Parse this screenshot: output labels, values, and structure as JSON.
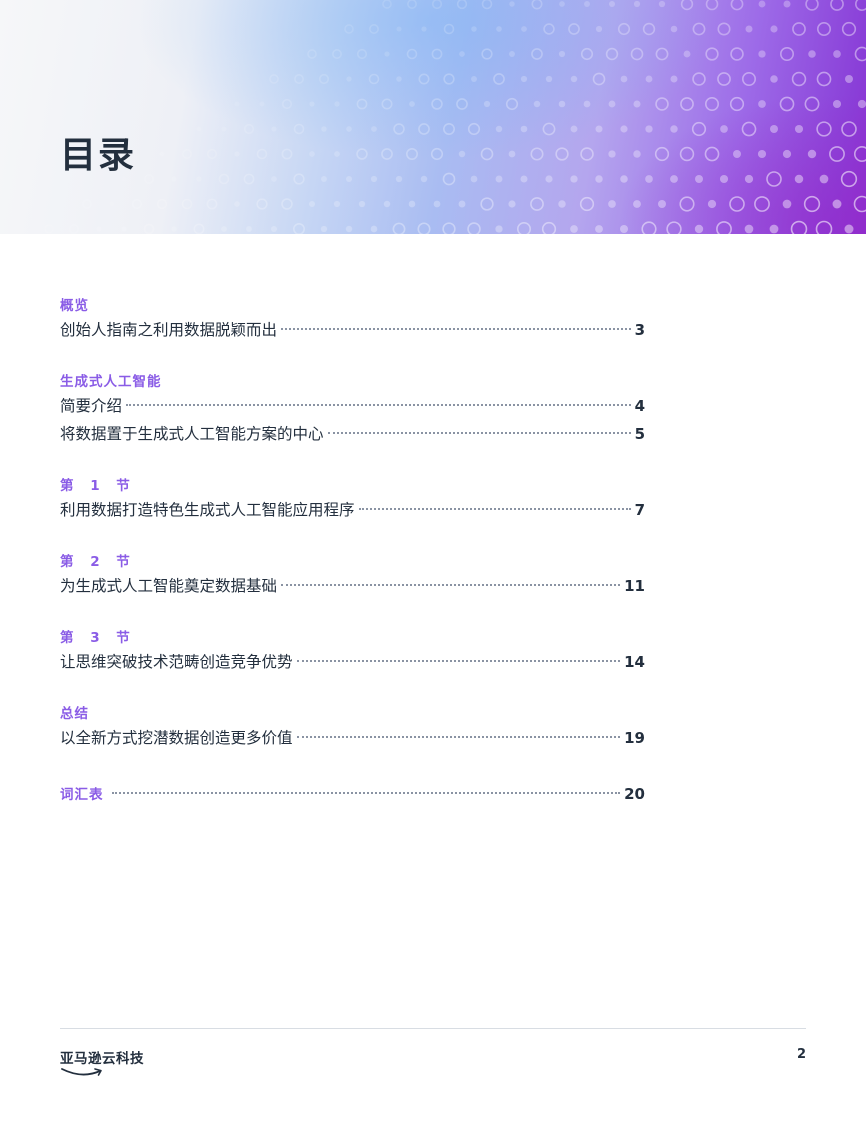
{
  "header": {
    "title": "目录"
  },
  "toc": {
    "overview": {
      "label": "概览",
      "entries": [
        {
          "title": "创始人指南之利用数据脱颖而出",
          "page": "3"
        }
      ]
    },
    "genai": {
      "label": "生成式人工智能",
      "entries": [
        {
          "title": "简要介绍",
          "page": "4"
        },
        {
          "title": "将数据置于生成式人工智能方案的中心",
          "page": "5"
        }
      ]
    },
    "section1": {
      "label": "第 1 节",
      "entries": [
        {
          "title": "利用数据打造特色生成式人工智能应用程序",
          "page": "7"
        }
      ]
    },
    "section2": {
      "label": "第 2 节",
      "entries": [
        {
          "title": "为生成式人工智能奠定数据基础",
          "page": "11"
        }
      ]
    },
    "section3": {
      "label": "第 3 节",
      "entries": [
        {
          "title": "让思维突破技术范畴创造竞争优势",
          "page": "14"
        }
      ]
    },
    "summary": {
      "label": "总结",
      "entries": [
        {
          "title": "以全新方式挖潜数据创造更多价值",
          "page": "19"
        }
      ]
    },
    "glossary": {
      "title": "词汇表",
      "page": "20"
    }
  },
  "footer": {
    "logo_text": "亚马逊云科技",
    "page_number": "2"
  },
  "colors": {
    "accent": "#8a5ce6",
    "text": "#232f3e",
    "leader": "#8a93a3"
  },
  "icons": {
    "logo": "amazon-smile-arrow-icon"
  }
}
